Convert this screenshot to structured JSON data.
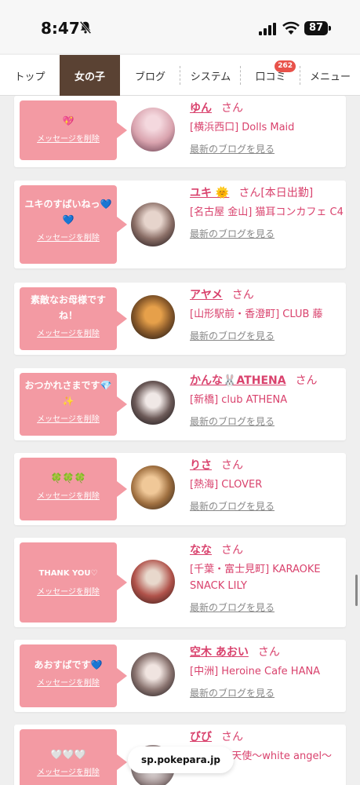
{
  "status_bar": {
    "time": "8:47",
    "battery": "87"
  },
  "nav": {
    "tabs": [
      {
        "label": "トップ",
        "badge": ""
      },
      {
        "label": "女の子",
        "badge": ""
      },
      {
        "label": "ブログ",
        "badge": ""
      },
      {
        "label": "システム",
        "badge": ""
      },
      {
        "label": "口コミ",
        "badge": "262"
      },
      {
        "label": "メニュー",
        "badge": ""
      }
    ],
    "active_index": 1
  },
  "common": {
    "delete_label": "メッセージを削除",
    "blog_label": "最新のブログを見る",
    "san": "さん"
  },
  "messages": [
    {
      "message": "💖",
      "name": "ゆん",
      "after_san": "",
      "shop": "[横浜西口] Dolls Maid"
    },
    {
      "message": "ユキのすばいねっ💙💙",
      "name": "ユキ 🌞",
      "after_san": "[本日出勤]",
      "shop": "[名古屋 金山] 猫耳コンカフェ C4"
    },
    {
      "message": "素敵なお母様ですね！",
      "name": "アヤメ",
      "after_san": "",
      "shop": "[山形駅前・香澄町] CLUB 藤"
    },
    {
      "message": "おつかれさまです💎✨",
      "name": "かんな🐰ATHENA",
      "after_san": "",
      "shop": "[新橋] club ATHENA"
    },
    {
      "message": "🍀🍀🍀",
      "name": "りさ",
      "after_san": "",
      "shop": "[熱海] CLOVER"
    },
    {
      "message": "THANK YOU♡",
      "name": "なな",
      "after_san": "",
      "shop": "[千葉・富士見町] KARAOKE SNACK LILY"
    },
    {
      "message": "あおすばです💙",
      "name": "空木 あおい",
      "after_san": "",
      "shop": "[中洲] Heroine Cafe HANA"
    },
    {
      "message": "🤍🤍🤍",
      "name": "びび",
      "after_san": "",
      "shop": "[南] ろの天使〜white angel〜"
    }
  ],
  "url_bar": {
    "domain": "sp.pokepara.jp"
  },
  "colors": {
    "accent": "#d9426d",
    "bubble": "#f39aa3",
    "active_tab": "#5a4233",
    "badge": "#e8524a"
  }
}
